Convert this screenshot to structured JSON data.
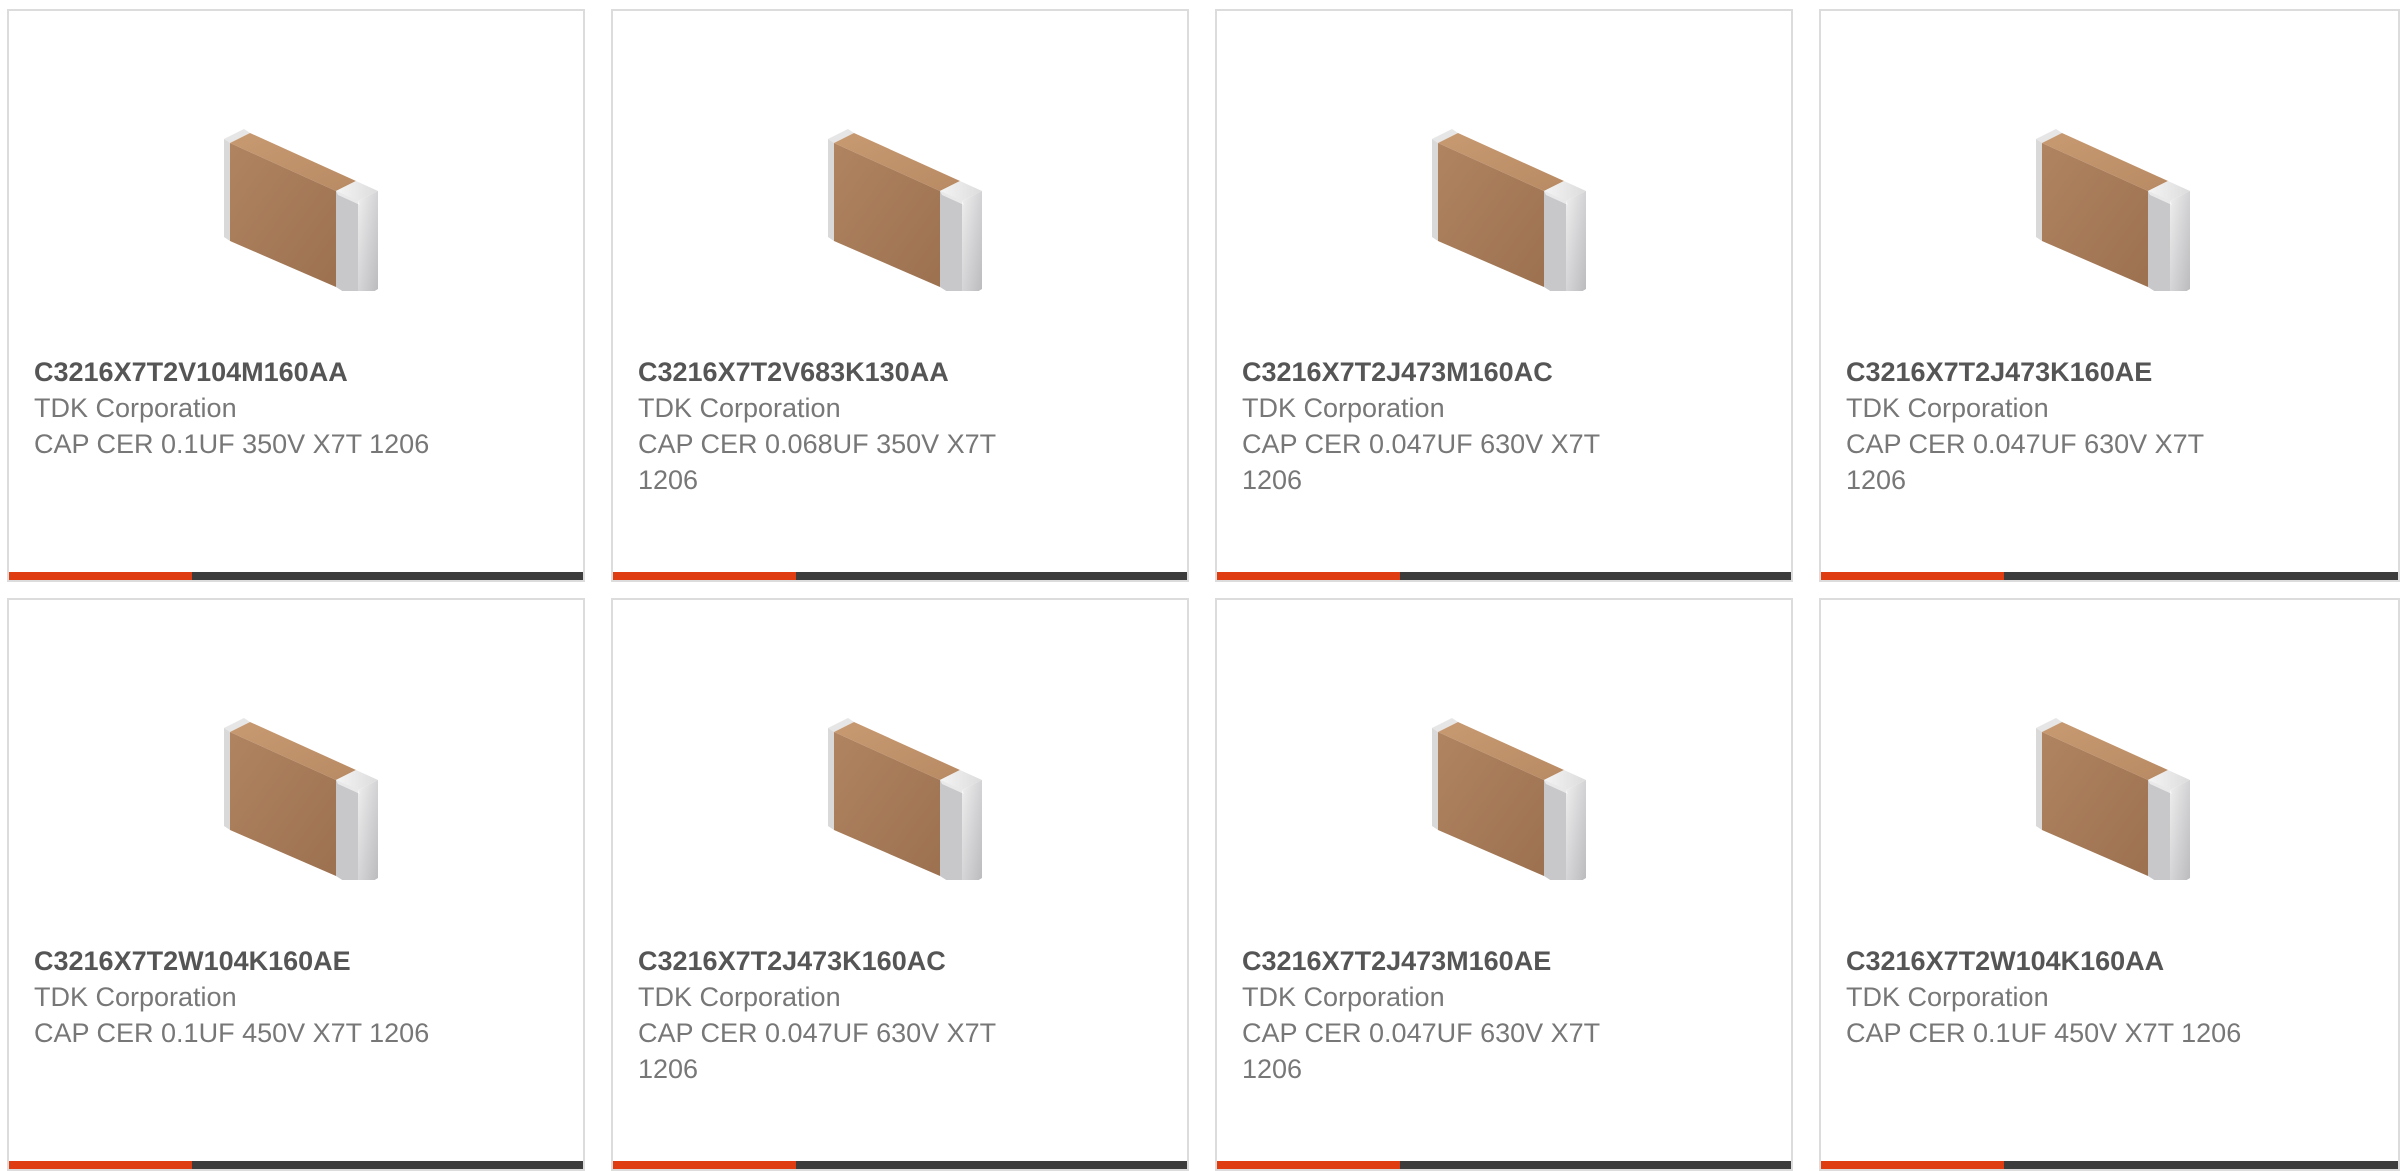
{
  "colors": {
    "accent": "#e03c12",
    "bar": "#3c3c3c",
    "border": "#dcdcdc",
    "part_text": "#555555",
    "body_text": "#777777"
  },
  "products": [
    {
      "part_number": "C3216X7T2V104M160AA",
      "manufacturer": "TDK Corporation",
      "description_line1": "CAP CER 0.1UF 350V X7T 1206",
      "description_line2": "",
      "image_icon": "ceramic-capacitor-chip-icon"
    },
    {
      "part_number": "C3216X7T2V683K130AA",
      "manufacturer": "TDK Corporation",
      "description_line1": "CAP CER 0.068UF 350V X7T",
      "description_line2": "1206",
      "image_icon": "ceramic-capacitor-chip-icon"
    },
    {
      "part_number": "C3216X7T2J473M160AC",
      "manufacturer": "TDK Corporation",
      "description_line1": "CAP CER 0.047UF 630V X7T",
      "description_line2": "1206",
      "image_icon": "ceramic-capacitor-chip-icon"
    },
    {
      "part_number": "C3216X7T2J473K160AE",
      "manufacturer": "TDK Corporation",
      "description_line1": "CAP CER 0.047UF 630V X7T",
      "description_line2": "1206",
      "image_icon": "ceramic-capacitor-chip-icon"
    },
    {
      "part_number": "C3216X7T2W104K160AE",
      "manufacturer": "TDK Corporation",
      "description_line1": "CAP CER 0.1UF 450V X7T 1206",
      "description_line2": "",
      "image_icon": "ceramic-capacitor-chip-icon"
    },
    {
      "part_number": "C3216X7T2J473K160AC",
      "manufacturer": "TDK Corporation",
      "description_line1": "CAP CER 0.047UF 630V X7T",
      "description_line2": "1206",
      "image_icon": "ceramic-capacitor-chip-icon"
    },
    {
      "part_number": "C3216X7T2J473M160AE",
      "manufacturer": "TDK Corporation",
      "description_line1": "CAP CER 0.047UF 630V X7T",
      "description_line2": "1206",
      "image_icon": "ceramic-capacitor-chip-icon"
    },
    {
      "part_number": "C3216X7T2W104K160AA",
      "manufacturer": "TDK Corporation",
      "description_line1": "CAP CER 0.1UF 450V X7T 1206",
      "description_line2": "",
      "image_icon": "ceramic-capacitor-chip-icon"
    }
  ]
}
